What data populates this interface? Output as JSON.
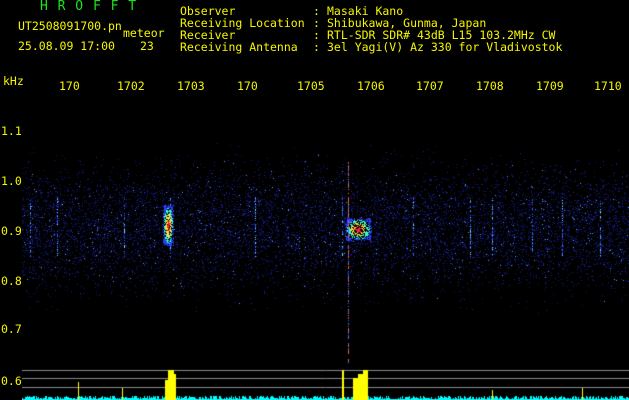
{
  "header": {
    "app_title": "H R O F F T",
    "file_name": "UT2508091700.pn",
    "meteor_label": "meteor",
    "datetime": "25.08.09 17:00",
    "meteor_count": "23",
    "rows": [
      {
        "label": "Observer",
        "value": "Masaki Kano"
      },
      {
        "label": "Receiving Location",
        "value": "Shibukawa, Gunma, Japan"
      },
      {
        "label": "Receiver",
        "value": "RTL-SDR SDR# 43dB L15 103.2MHz CW"
      },
      {
        "label": "Receiving Antenna",
        "value": "3el Yagi(V) Az 330 for Vladivostok"
      }
    ],
    "colon": ":"
  },
  "axes": {
    "y_unit": "kHz",
    "y_ticks": [
      "1.1",
      "1.0",
      "0.9",
      "0.8",
      "0.7",
      "0.6"
    ],
    "x_ticks": [
      "170",
      "1702",
      "1703",
      "170",
      "1705",
      "1706",
      "1707",
      "1708",
      "1709",
      "1710"
    ]
  },
  "colors": {
    "text_yellow": "#f6f600",
    "title_green": "#19e619",
    "noise_blue": "#2a3cff",
    "signal_red": "#ff2020",
    "echo_bar": "#ffff00",
    "baseline_cyan": "#00ffff"
  }
}
